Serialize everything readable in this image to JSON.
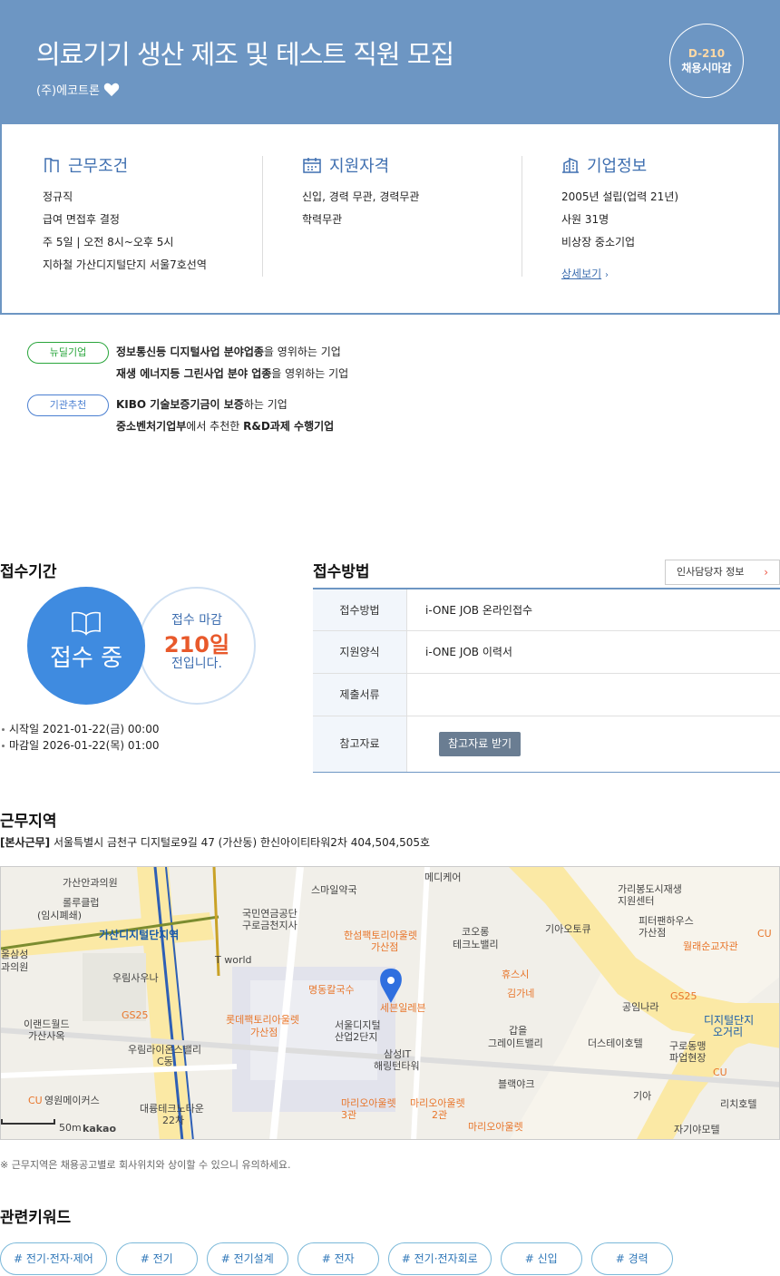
{
  "header": {
    "title": "의료기기 생산 제조 및 테스트 직원 모집",
    "company": "(주)에코트론",
    "dday": "D-210",
    "dday_status": "채용시마감"
  },
  "conditions": {
    "title": "근무조건",
    "items": [
      "정규직",
      "급여 면접후 결정",
      "주 5일 | 오전 8시~오후 5시",
      "지하철 가산디지털단지 서울7호선역"
    ]
  },
  "qualification": {
    "title": "지원자격",
    "items": [
      "신입, 경력 무관, 경력무관",
      "학력무관"
    ]
  },
  "company_info": {
    "title": "기업정보",
    "items": [
      "2005년 설립(업력 21년)",
      "사원 31명",
      "비상장 중소기업"
    ],
    "more": "상세보기"
  },
  "tags": [
    {
      "pill": "뉴딜기업",
      "lines": [
        {
          "bold": "정보통신등 디지털사업 분야업종",
          "rest": "을 영위하는 기업"
        },
        {
          "bold": "재생 에너지등 그린사업 분야 업종",
          "rest": "을 영위하는 기업"
        }
      ]
    },
    {
      "pill": "기관추천",
      "lines": [
        {
          "bold": "KIBO 기술보증기금이 보증",
          "rest": "하는 기업"
        },
        {
          "bold": "중소벤처기업부",
          "rest": "에서 추천한 ",
          "bold2": "R&D과제 수행기업"
        }
      ]
    }
  ],
  "period": {
    "title": "접수기간",
    "status": "접수 중",
    "remain_label": "접수 마감",
    "remain_days": "210일",
    "remain_suffix": "전입니다.",
    "start": "시작일 2021-01-22(금) 00:00",
    "end": "마감일 2026-01-22(목) 01:00"
  },
  "method": {
    "title": "접수방법",
    "hr_button": "인사담당자 정보",
    "rows": [
      {
        "k": "접수방법",
        "v": "i-ONE JOB 온라인접수"
      },
      {
        "k": "지원양식",
        "v": "i-ONE JOB 이력서"
      },
      {
        "k": "제출서류",
        "v": ""
      },
      {
        "k": "참고자료",
        "v": ""
      }
    ],
    "ref_button": "참고자료 받기"
  },
  "location": {
    "title": "근무지역",
    "label": "[본사근무]",
    "address": "서울특별시 금천구 디지털로9길 47 (가산동) 한신아이티타워2차 404,504,505호",
    "note": "※ 근무지역은 채용공고별로 회사위치와 상이할 수 있으니 유의하세요.",
    "map_scale": "50m",
    "map_brand": "kakao"
  },
  "keywords": {
    "title": "관련키워드",
    "items": [
      "# 전기·전자·제어",
      "# 전기",
      "# 전기설계",
      "# 전자",
      "# 전기·전자회로",
      "# 신입",
      "# 경력"
    ]
  },
  "colors": {
    "header": "#6d96c3",
    "accent": "#3f8be0",
    "orange": "#e8592b"
  }
}
